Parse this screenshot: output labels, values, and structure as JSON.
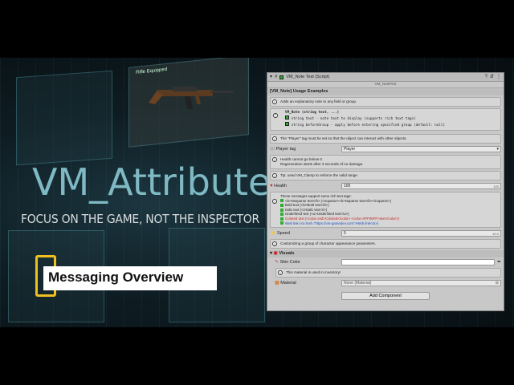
{
  "hero": {
    "title": "VM_Attributes",
    "tagline": "FOCUS ON THE GAME, NOT THE INSPECTOR",
    "badge": "Messaging Overview",
    "gun_card": "Rifle Equipped"
  },
  "inspector": {
    "component_title": "VM_Note Test (Script)",
    "script_ref": "VM_NoteTest",
    "section_title": "[VM_Note] Usage Examples",
    "note1": "Adds an explanatory note to any field or group.",
    "sig_title": "VM_Note (string text, ...)",
    "sig_line1": "string text - note text to display (supports rich text tags)",
    "sig_line2": "string beforeGroup - apply before entering specified group (default: null)",
    "note_player": "The \"Player\" tag must be set so that the object can interact with other objects.",
    "player_tag_label": "Player tag",
    "player_tag_value": "Player",
    "note_health1": "Health cannot go below 0.",
    "note_health2": "Regeneration starts after 3 seconds of no damage.",
    "note_tip": "Tip: used VM_Clamp to enforce the valid range.",
    "health_label": "Health",
    "health_value": "100",
    "health_max": "100",
    "rich_header": "These messages support some rich text tags:",
    "rich_lines": [
      "<b>Nosparse text</b> (<noparse><b>Noparse text</b></noparse>)",
      "Bold text (<b>Bold text</b>)",
      "Italic text (<i>Italic text</i>)",
      "Underlined text (<u>Underlined text</u>)",
      "Colored text (<color=red>Colored</color> <color=#FF00FF>text</color>)",
      "Web link (<a href=\"https://vm-gamedev.com\">Web link</a>)"
    ],
    "speed_label": "Speed",
    "speed_value": "5",
    "speed_max": "10.0",
    "note_custom": "Customizing a group of character appearance parameters.",
    "visuals_label": "Visuals",
    "skin_label": "Skin Color",
    "note_material": "This material is used in inventory!",
    "material_label": "Material",
    "material_value": "None (Material)",
    "add_component": "Add Component"
  }
}
